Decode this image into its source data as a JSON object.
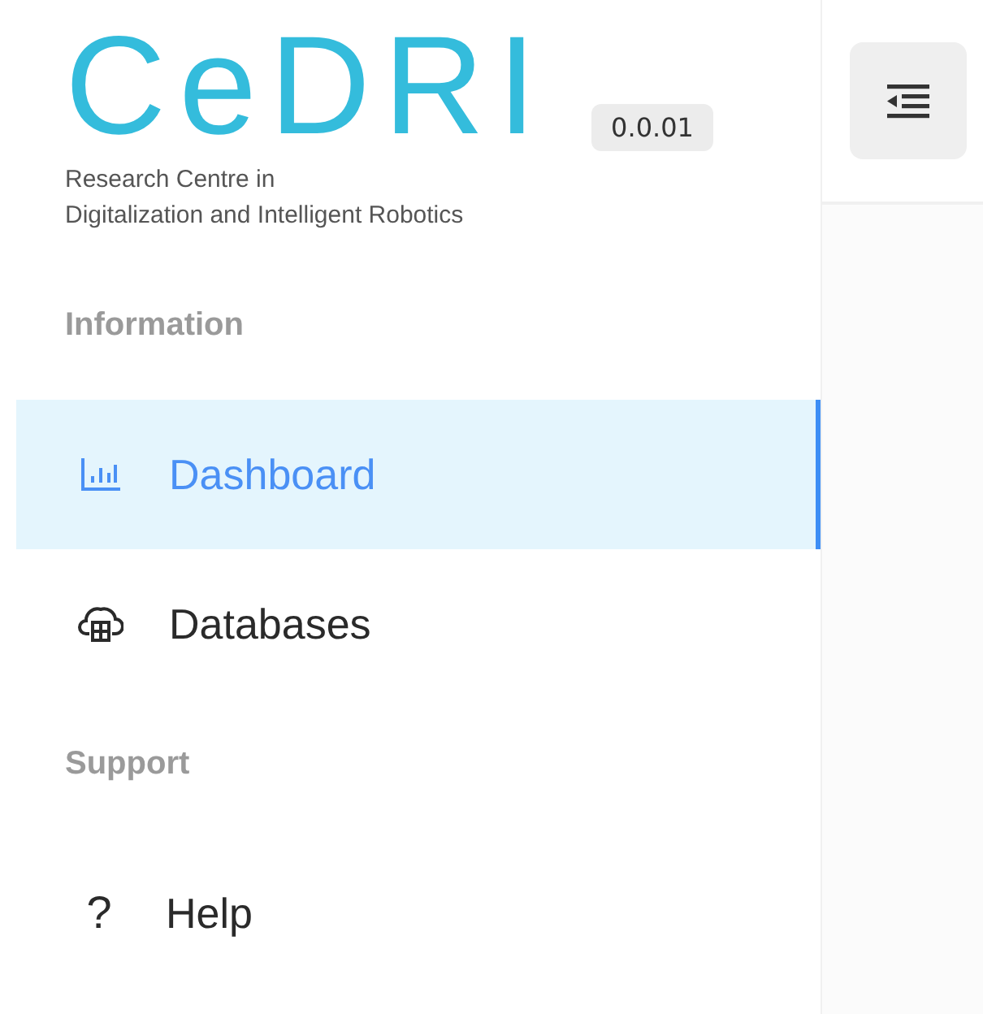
{
  "logo": {
    "text": "CeDRI",
    "subtitle": [
      "Research Centre in",
      "Digitalization and Intelligent Robotics"
    ]
  },
  "version": "0.0.01",
  "sections": [
    {
      "title": "Information",
      "items": [
        {
          "label": "Dashboard",
          "kind": "chart",
          "selected": true
        },
        {
          "label": "Databases",
          "kind": "cloud-db",
          "selected": false
        }
      ]
    },
    {
      "title": "Support",
      "items": [
        {
          "label": "Help",
          "kind": "glyph",
          "glyph": "?",
          "selected": false
        }
      ]
    }
  ]
}
